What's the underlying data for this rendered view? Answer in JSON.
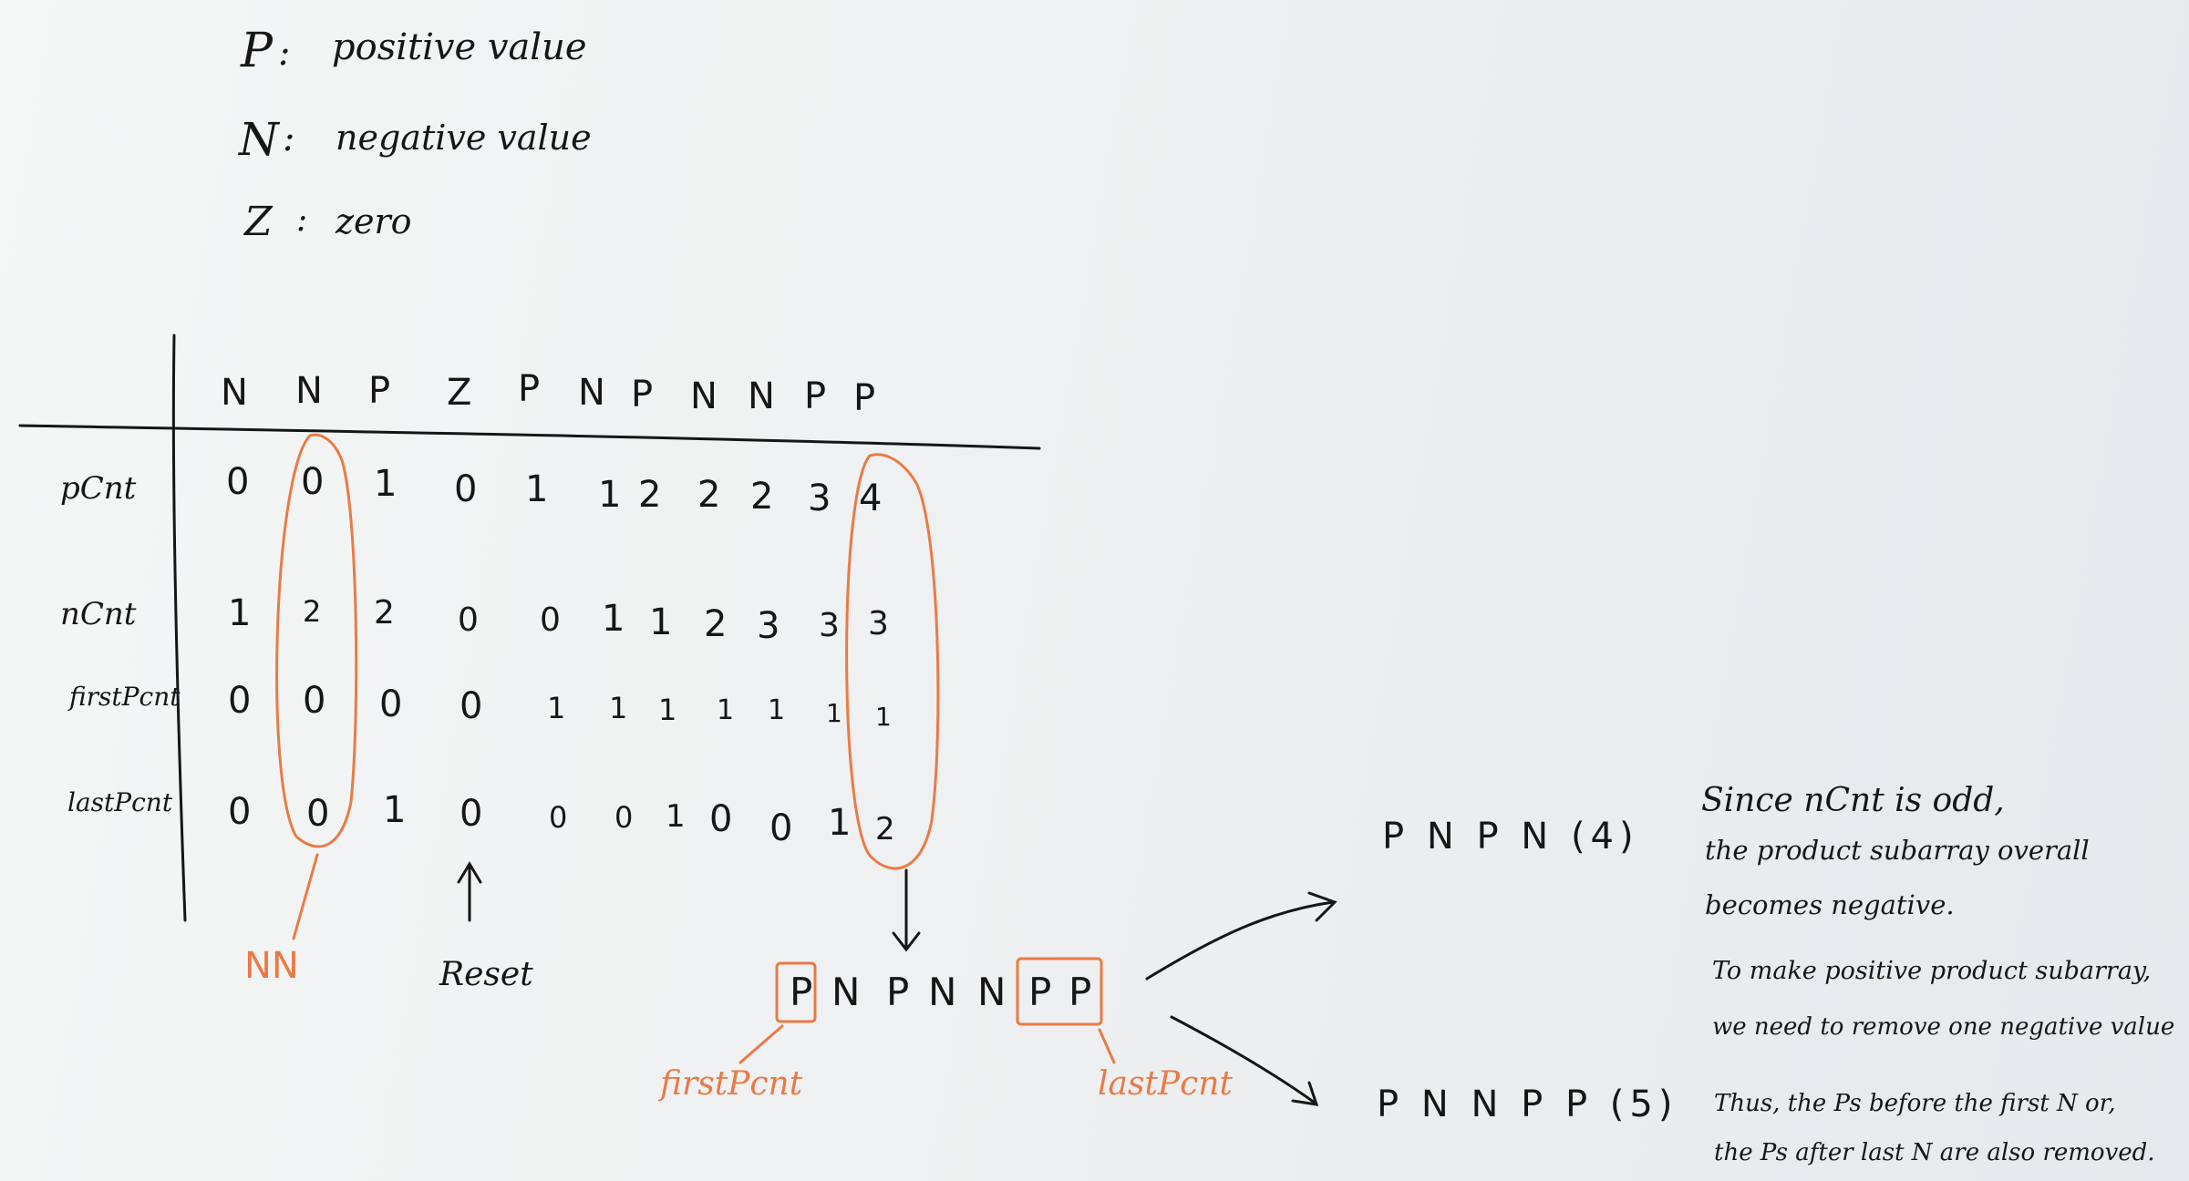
{
  "legend": [
    {
      "key": "P",
      "desc": "positive value"
    },
    {
      "key": "N",
      "desc": "negative value"
    },
    {
      "key": "Z",
      "desc": "zero"
    }
  ],
  "table": {
    "columns": [
      "N",
      "N",
      "P",
      "Z",
      "P",
      "N",
      "P",
      "N",
      "N",
      "P",
      "P"
    ],
    "rows": [
      {
        "label": "pCnt",
        "values": [
          "0",
          "0",
          "1",
          "0",
          "1",
          "1",
          "2",
          "2",
          "2",
          "3",
          "4"
        ]
      },
      {
        "label": "nCnt",
        "values": [
          "1",
          "2",
          "2",
          "0",
          "0",
          "1",
          "1",
          "2",
          "3",
          "3",
          "3"
        ]
      },
      {
        "label": "firstPcnt",
        "values": [
          "0",
          "0",
          "0",
          "0",
          "1",
          "1",
          "1",
          "1",
          "1",
          "1",
          "1"
        ]
      },
      {
        "label": "lastPcnt",
        "values": [
          "0",
          "0",
          "1",
          "0",
          "0",
          "0",
          "1",
          "0",
          "0",
          "1",
          "2"
        ]
      }
    ]
  },
  "annotations": {
    "nn": "NN",
    "reset": "Reset",
    "sequence": [
      "P",
      "N",
      "P",
      "N",
      "N",
      "P",
      "P"
    ],
    "first_pcnt": "firstPcnt",
    "last_pcnt": "lastPcnt",
    "option_a": "P N P N (4)",
    "option_b": "P N N P P (5)"
  },
  "notes": [
    "Since nCnt is odd,",
    "the product subarray overall",
    "becomes negative.",
    "To make positive product subarray,",
    "we need to remove one negative value",
    "Thus, the Ps before the first N or,",
    "the Ps after last N are also removed."
  ],
  "colors": {
    "ink": "#161616",
    "marker_orange": "#ea7a45"
  }
}
